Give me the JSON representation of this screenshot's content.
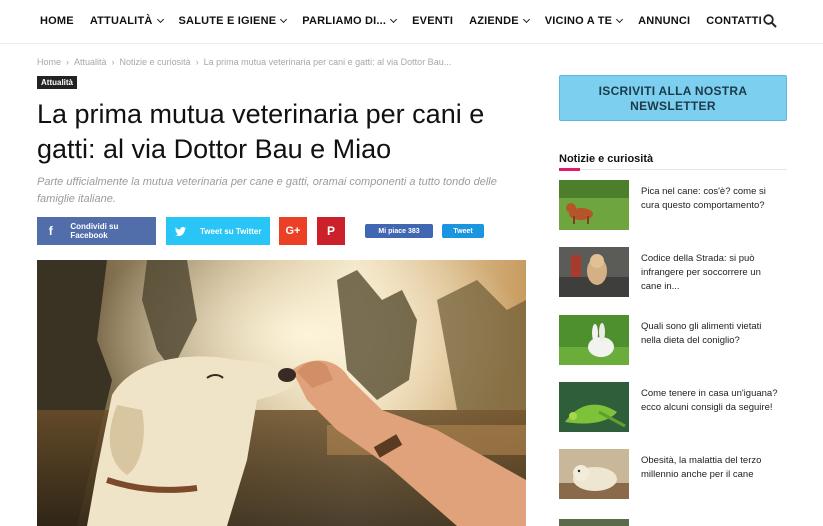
{
  "nav": {
    "items": [
      {
        "label": "HOME",
        "dropdown": false
      },
      {
        "label": "ATTUALITÀ",
        "dropdown": true
      },
      {
        "label": "SALUTE E IGIENE",
        "dropdown": true
      },
      {
        "label": "PARLIAMO DI...",
        "dropdown": true
      },
      {
        "label": "EVENTI",
        "dropdown": false
      },
      {
        "label": "AZIENDE",
        "dropdown": true
      },
      {
        "label": "VICINO A TE",
        "dropdown": true
      },
      {
        "label": "ANNUNCI",
        "dropdown": false
      },
      {
        "label": "CONTATTI",
        "dropdown": false
      }
    ],
    "search_icon": "search-icon"
  },
  "breadcrumb": {
    "items": [
      "Home",
      "Attualità",
      "Notizie e curiosità",
      "La prima mutua veterinaria per cani e gatti: al via Dottor Bau..."
    ],
    "separator": "›"
  },
  "article": {
    "category": "Attualità",
    "title": "La prima mutua veterinaria per cani e gatti: al via Dottor Bau e Miao",
    "subtitle": "Parte ufficialmente la mutua veterinaria per cane e gatti, oramai componenti a tutto tondo delle famiglie italiane."
  },
  "share": {
    "facebook_label": "Condividi su Facebook",
    "twitter_label": "Tweet su Twitter",
    "gplus_label": "G+",
    "pinterest_label": "P",
    "like_label": "Mi piace 383",
    "tweet_label": "Tweet"
  },
  "colors": {
    "facebook": "#516eab",
    "twitter": "#29c5f6",
    "gplus": "#eb4026",
    "pinterest": "#ca212a",
    "newsletter": "#7ccfee",
    "accent": "#e11a6b"
  },
  "sidebar": {
    "newsletter_label": "ISCRIVITI ALLA NOSTRA NEWSLETTER",
    "section_title": "Notizie e curiosità",
    "items": [
      {
        "title": "Pica nel cane: cos'è? come si cura questo comportamento?"
      },
      {
        "title": "Codice della Strada: si può infrangere per soccorrere un cane in..."
      },
      {
        "title": "Quali sono gli alimenti vietati nella dieta del coniglio?"
      },
      {
        "title": "Come tenere in casa un'iguana? ecco alcuni consigli da seguire!"
      },
      {
        "title": "Obesità, la malattia del terzo millennio anche per il cane"
      }
    ]
  }
}
